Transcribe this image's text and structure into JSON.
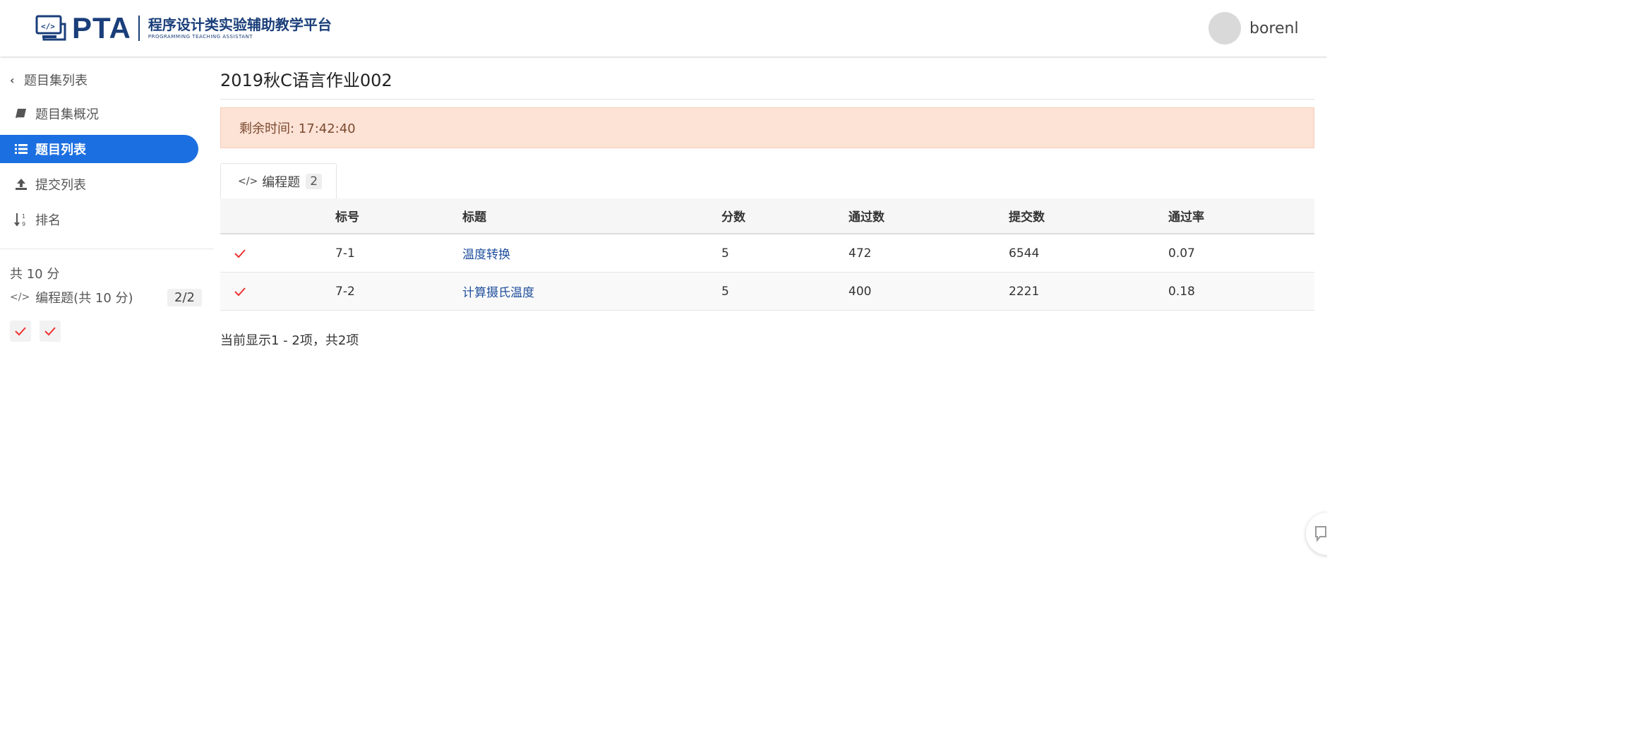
{
  "header": {
    "logo_text": "PTA",
    "logo_cn": "程序设计类实验辅助教学平台",
    "logo_en": "PROGRAMMING TEACHING ASSISTANT",
    "username": "borenl",
    "brand_color": "#1a3e7a"
  },
  "sidebar": {
    "back_label": "题目集列表",
    "items": [
      {
        "label": "题目集概况",
        "icon": "book-icon"
      },
      {
        "label": "题目列表",
        "icon": "list-icon",
        "active": true
      },
      {
        "label": "提交列表",
        "icon": "upload-icon"
      },
      {
        "label": "排名",
        "icon": "sort-numeric-icon"
      }
    ],
    "total": "共 10 分",
    "category_label": "编程题(共 10 分)",
    "category_badge": "2/2",
    "accent_color": "#1c6fe0"
  },
  "main": {
    "title": "2019秋C语言作业002",
    "timer": "剩余时间: 17:42:40",
    "tab_label": "编程题",
    "tab_count": "2",
    "columns": [
      "标号",
      "标题",
      "分数",
      "通过数",
      "提交数",
      "通过率"
    ],
    "rows": [
      {
        "id": "7-1",
        "title": "温度转换",
        "score": "5",
        "passed": "472",
        "submitted": "6544",
        "rate": "0.07"
      },
      {
        "id": "7-2",
        "title": "计算摄氏温度",
        "score": "5",
        "passed": "400",
        "submitted": "2221",
        "rate": "0.18"
      }
    ],
    "footer": "当前显示1 - 2项，共2项"
  }
}
